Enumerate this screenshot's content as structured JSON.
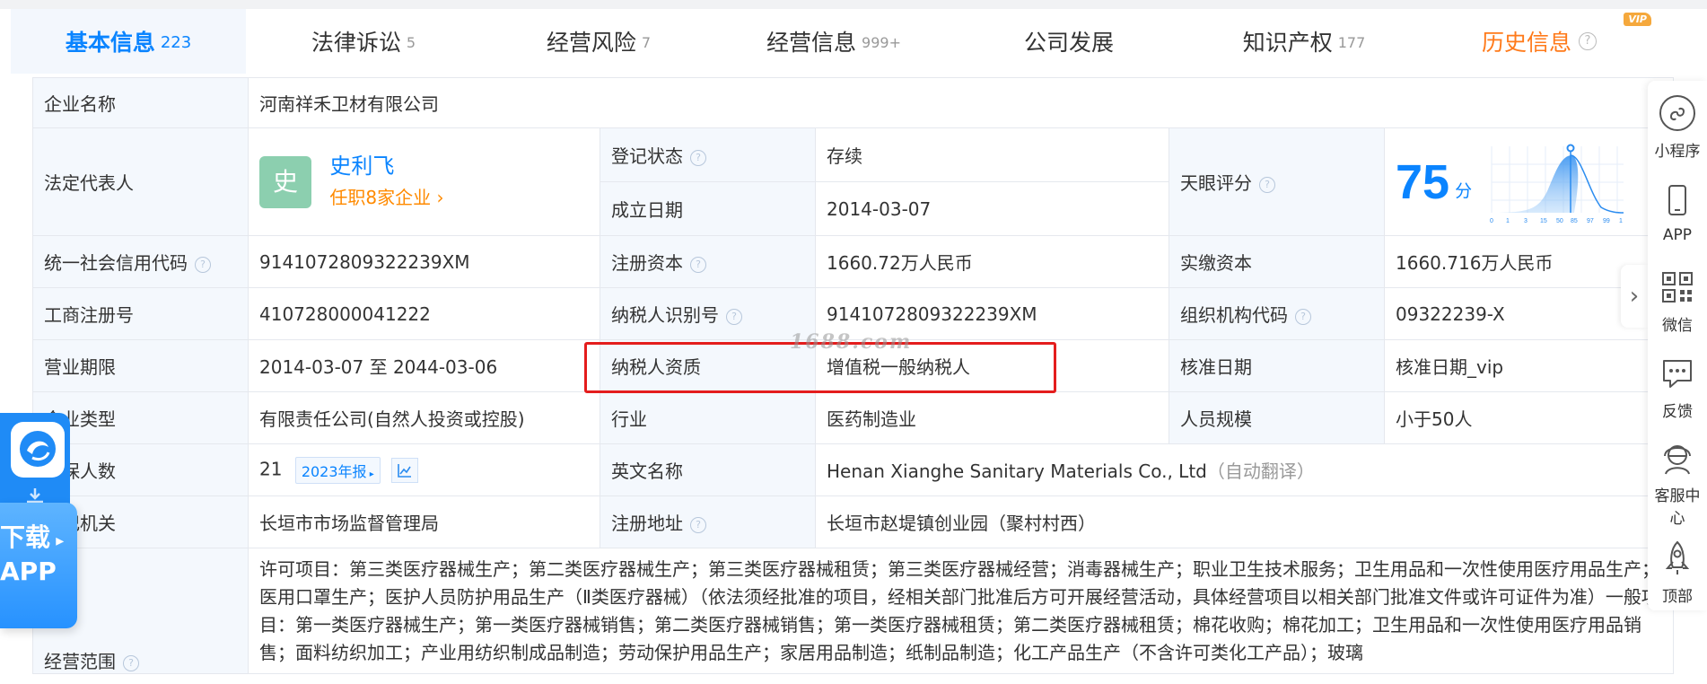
{
  "tabs": [
    {
      "label": "基本信息",
      "count": "223"
    },
    {
      "label": "法律诉讼",
      "count": "5"
    },
    {
      "label": "经营风险",
      "count": "7"
    },
    {
      "label": "经营信息",
      "count": "999+"
    },
    {
      "label": "公司发展",
      "count": ""
    },
    {
      "label": "知识产权",
      "count": "177"
    },
    {
      "label": "历史信息",
      "count": "",
      "badge": "VIP",
      "help": "?"
    }
  ],
  "company": {
    "name_label": "企业名称",
    "name": "河南祥禾卫材有限公司",
    "legal_label": "法定代表人",
    "legal_avatar": "史",
    "legal_name": "史利飞",
    "legal_sub": "任职8家企业 ›",
    "status_label": "登记状态",
    "status": "存续",
    "founded_label": "成立日期",
    "founded": "2014-03-07",
    "score_label": "天眼评分",
    "score": "75",
    "score_unit": "分",
    "score_axis": [
      "0",
      "1",
      "3",
      "15",
      "50",
      "85",
      "97",
      "99",
      "1"
    ],
    "credit_label": "统一社会信用代码",
    "credit": "9141072809322239XM",
    "reg_cap_label": "注册资本",
    "reg_cap": "1660.72万人民币",
    "paid_cap_label": "实缴资本",
    "paid_cap": "1660.716万人民币",
    "biz_no_label": "工商注册号",
    "biz_no": "410728000041222",
    "tax_id_label": "纳税人识别号",
    "tax_id": "9141072809322239XM",
    "org_code_label": "组织机构代码",
    "org_code": "09322239-X",
    "term_label": "营业期限",
    "term": "2014-03-07 至 2044-03-06",
    "tax_qual_label": "纳税人资质",
    "tax_qual": "增值税一般纳税人",
    "approve_label": "核准日期",
    "approve": "核准日期_vip",
    "type_label": "企业类型",
    "type": "有限责任公司(自然人投资或控股)",
    "industry_label": "行业",
    "industry": "医药制造业",
    "staff_label": "人员规模",
    "staff": "小于50人",
    "insured_label": "参保人数",
    "insured": "21",
    "insured_year": "2023年报",
    "en_label": "英文名称",
    "en_name": "Henan Xianghe Sanitary Materials Co., Ltd",
    "en_note": "（自动翻译）",
    "authority_label": "登记机关",
    "authority": "长垣市市场监督管理局",
    "address_label": "注册地址",
    "address": "长垣市赵堤镇创业园（聚村村西）",
    "scope_label": "经营范围",
    "scope": "许可项目：第三类医疗器械生产；第二类医疗器械生产；第三类医疗器械租赁；第三类医疗器械经营；消毒器械生产；职业卫生技术服务；卫生用品和一次性使用医疗用品生产；医用口罩生产；医护人员防护用品生产（Ⅱ类医疗器械）（依法须经批准的项目，经相关部门批准后方可开展经营活动，具体经营项目以相关部门批准文件或许可证件为准）一般项目：第一类医疗器械生产；第一类医疗器械销售；第二类医疗器械销售；第一类医疗器械租赁；第二类医疗器械租赁；棉花收购；棉花加工；卫生用品和一次性使用医疗用品销售；面料纺织加工；产业用纺织制成品制造；劳动保护用品生产；家居用品制造；纸制品制造；化工产品生产（不含许可类化工产品）；玻璃"
  },
  "watermark": "1688.com",
  "sidebar": {
    "mini_program": "小程序",
    "app": "APP",
    "wechat": "微信",
    "feedback": "反馈",
    "service": "客服中心",
    "top": "顶部"
  },
  "download": {
    "line1": "下载",
    "line2": "APP"
  },
  "colors": {
    "accent": "#0a84ff",
    "history": "#ff7a1a",
    "highlight": "#e41d1d",
    "status_green": "#2eaa55"
  }
}
